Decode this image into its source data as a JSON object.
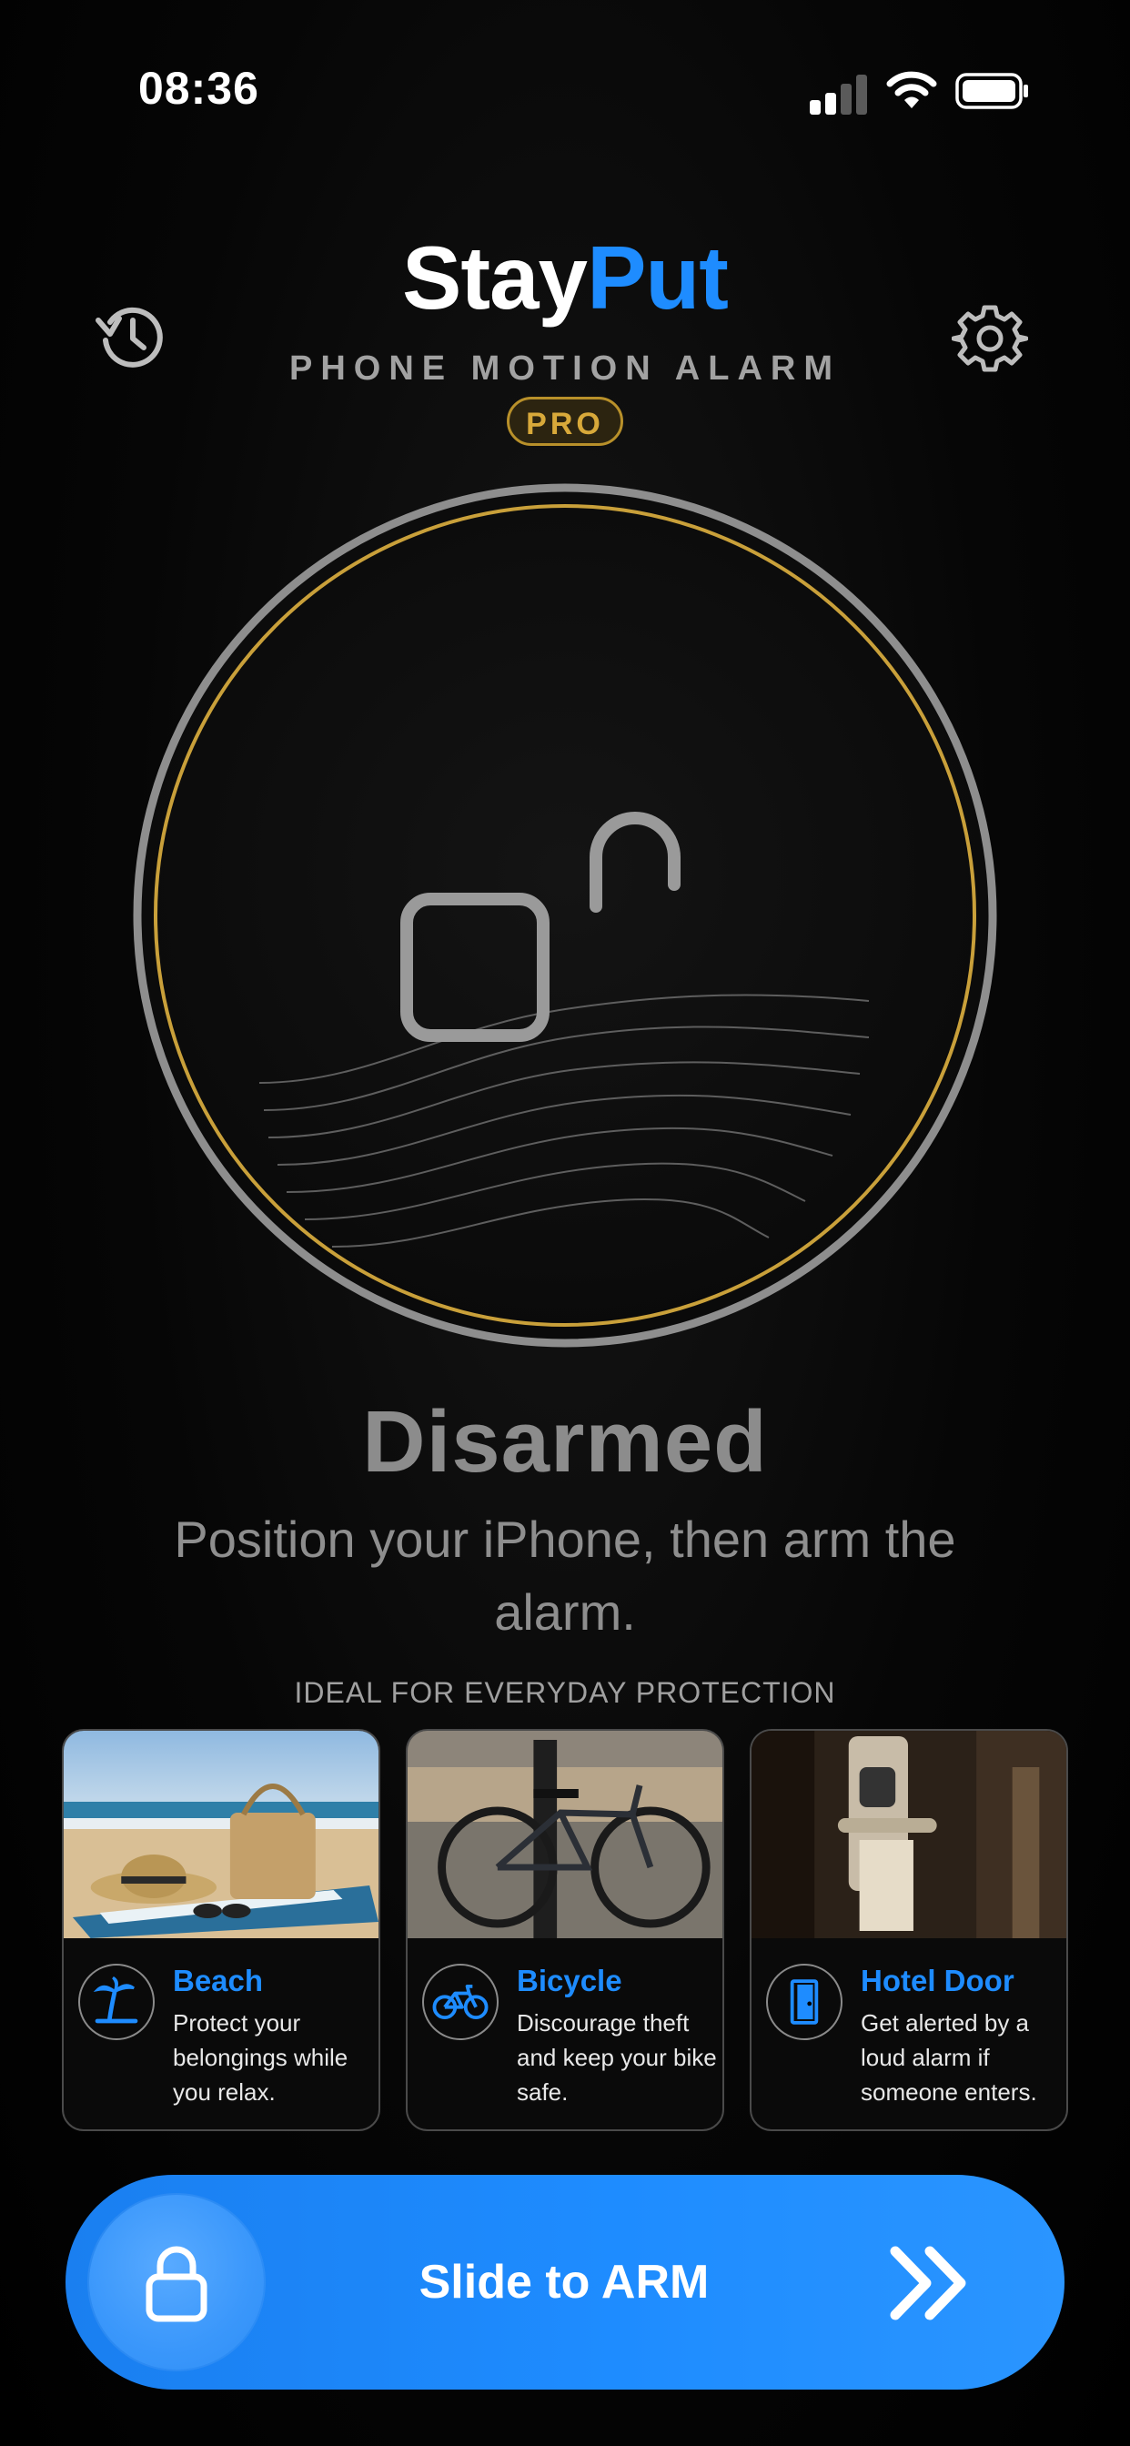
{
  "status_bar": {
    "time": "08:36"
  },
  "header": {
    "brand_part1": "Stay",
    "brand_part2": "Put",
    "subtitle": "PHONE MOTION ALARM",
    "badge": "PRO"
  },
  "alarm": {
    "status": "Disarmed",
    "hint": "Position your iPhone, then arm the alarm."
  },
  "use_cases": {
    "heading": "IDEAL FOR EVERYDAY PROTECTION",
    "cards": [
      {
        "title": "Beach",
        "description": "Protect your belongings while you relax.",
        "icon": "palm-tree-icon"
      },
      {
        "title": "Bicycle",
        "description": "Discourage theft and keep your bike safe.",
        "icon": "bicycle-icon"
      },
      {
        "title": "Hotel Door",
        "description": "Get alerted by a loud alarm if someone enters.",
        "icon": "door-icon"
      }
    ]
  },
  "slider": {
    "label": "Slide to ARM"
  },
  "colors": {
    "accent": "#1e8cff",
    "gold": "#c9a03a",
    "muted_text": "#8c8c8c",
    "background": "#000000"
  }
}
